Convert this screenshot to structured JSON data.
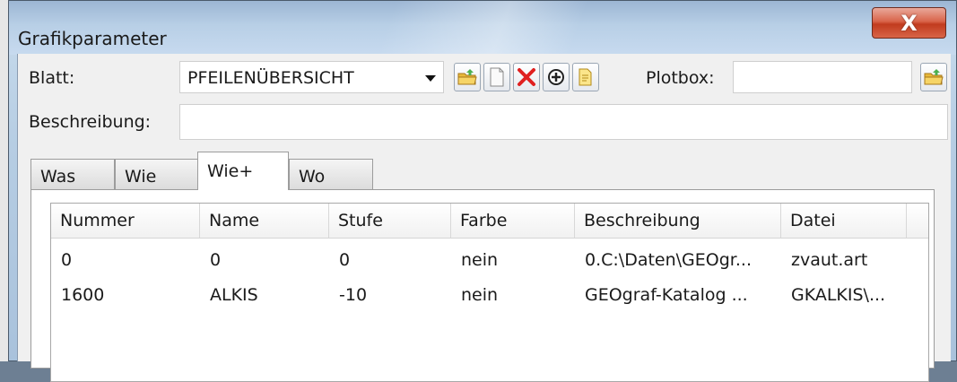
{
  "window": {
    "title": "Grafikparameter",
    "close_label": "X"
  },
  "form": {
    "blatt_label": "Blatt:",
    "blatt_value": "PFEILENÜBERSICHT",
    "plotbox_label": "Plotbox:",
    "plotbox_value": "",
    "beschreibung_label": "Beschreibung:",
    "beschreibung_value": ""
  },
  "toolbar": {
    "buttons": [
      "open-folder-icon",
      "new-page-icon",
      "delete-icon",
      "add-circle-icon",
      "copy-page-icon"
    ]
  },
  "tabs": [
    {
      "label": "Was",
      "active": false
    },
    {
      "label": "Wie",
      "active": false
    },
    {
      "label": "Wie+",
      "active": true
    },
    {
      "label": "Wo",
      "active": false
    }
  ],
  "table": {
    "columns": [
      "Nummer",
      "Name",
      "Stufe",
      "Farbe",
      "Beschreibung",
      "Datei"
    ],
    "rows": [
      [
        "0",
        "0",
        "0",
        "nein",
        "0.C:\\Daten\\GEOgr...",
        "zvaut.art"
      ],
      [
        "1600",
        "ALKIS",
        "-10",
        "nein",
        "GEOgraf-Katalog ...",
        "GKALKIS\\..."
      ]
    ]
  },
  "colors": {
    "close_button": "#c13b1e",
    "delete_icon": "#e02020",
    "folder_icon": "#e8b93a"
  }
}
